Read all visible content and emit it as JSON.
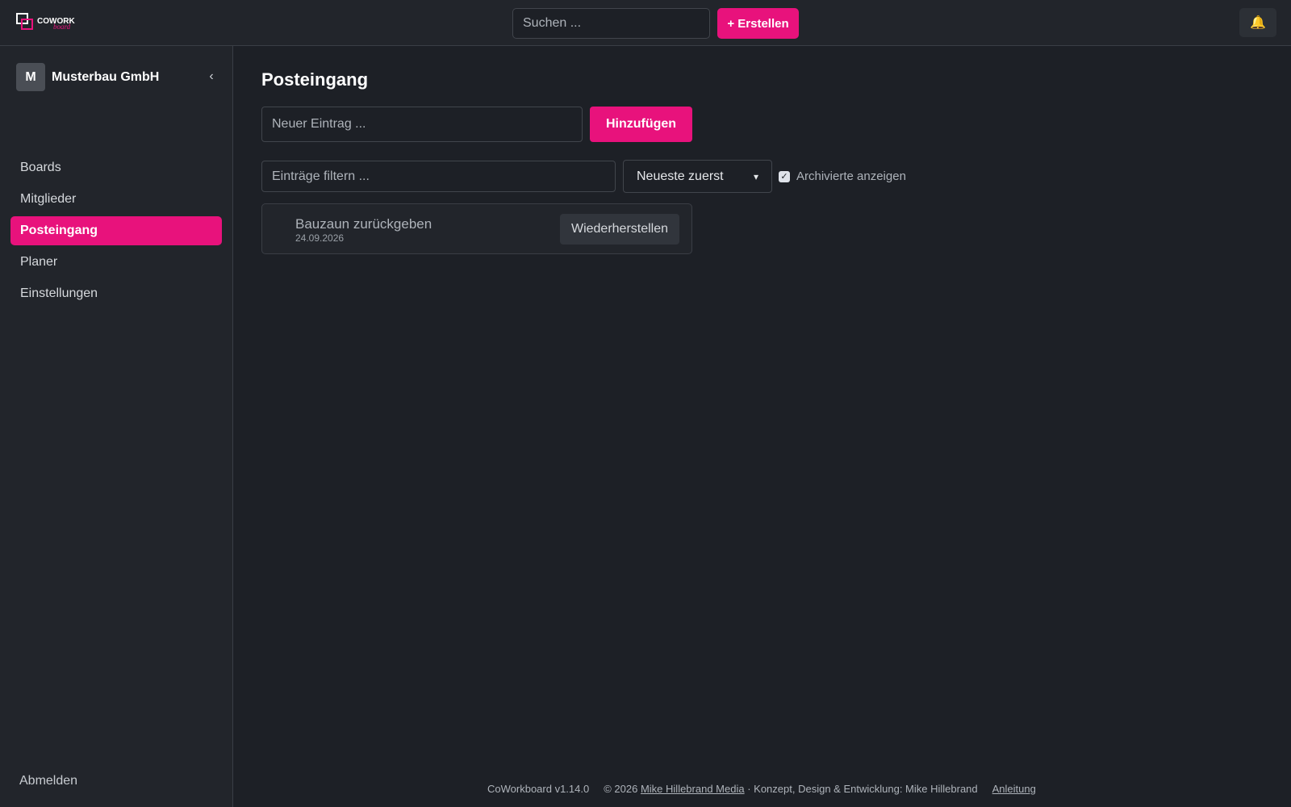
{
  "header": {
    "search_placeholder": "Suchen ...",
    "create_label": "+ Erstellen",
    "bell_icon": "🔔"
  },
  "sidebar": {
    "workspace_initial": "M",
    "workspace_name": "Musterbau GmbH",
    "collapse_icon": "‹",
    "items": [
      {
        "label": "Boards"
      },
      {
        "label": "Mitglieder"
      },
      {
        "label": "Posteingang",
        "active": true
      },
      {
        "label": "Planer"
      },
      {
        "label": "Einstellungen"
      }
    ],
    "logout_label": "Abmelden"
  },
  "main": {
    "title": "Posteingang",
    "new_entry_placeholder": "Neuer Eintrag ...",
    "add_label": "Hinzufügen",
    "filter_placeholder": "Einträge filtern ...",
    "sort_selected": "Neueste zuerst",
    "show_archived_label": "Archivierte anzeigen",
    "show_archived_checked": true,
    "entries": [
      {
        "title": "Bauzaun zurückgeben",
        "date": "24.09.2026",
        "action": "Wiederherstellen"
      }
    ]
  },
  "footer": {
    "version": "CoWorkboard v1.14.0",
    "copyright_prefix": "© 2026",
    "company_link": "Mike Hillebrand Media",
    "credit": "· Konzept, Design & Entwicklung: Mike Hillebrand",
    "manual_link": "Anleitung"
  },
  "colors": {
    "accent": "#e8127c",
    "background": "#1d2026",
    "panel": "#22252b"
  }
}
